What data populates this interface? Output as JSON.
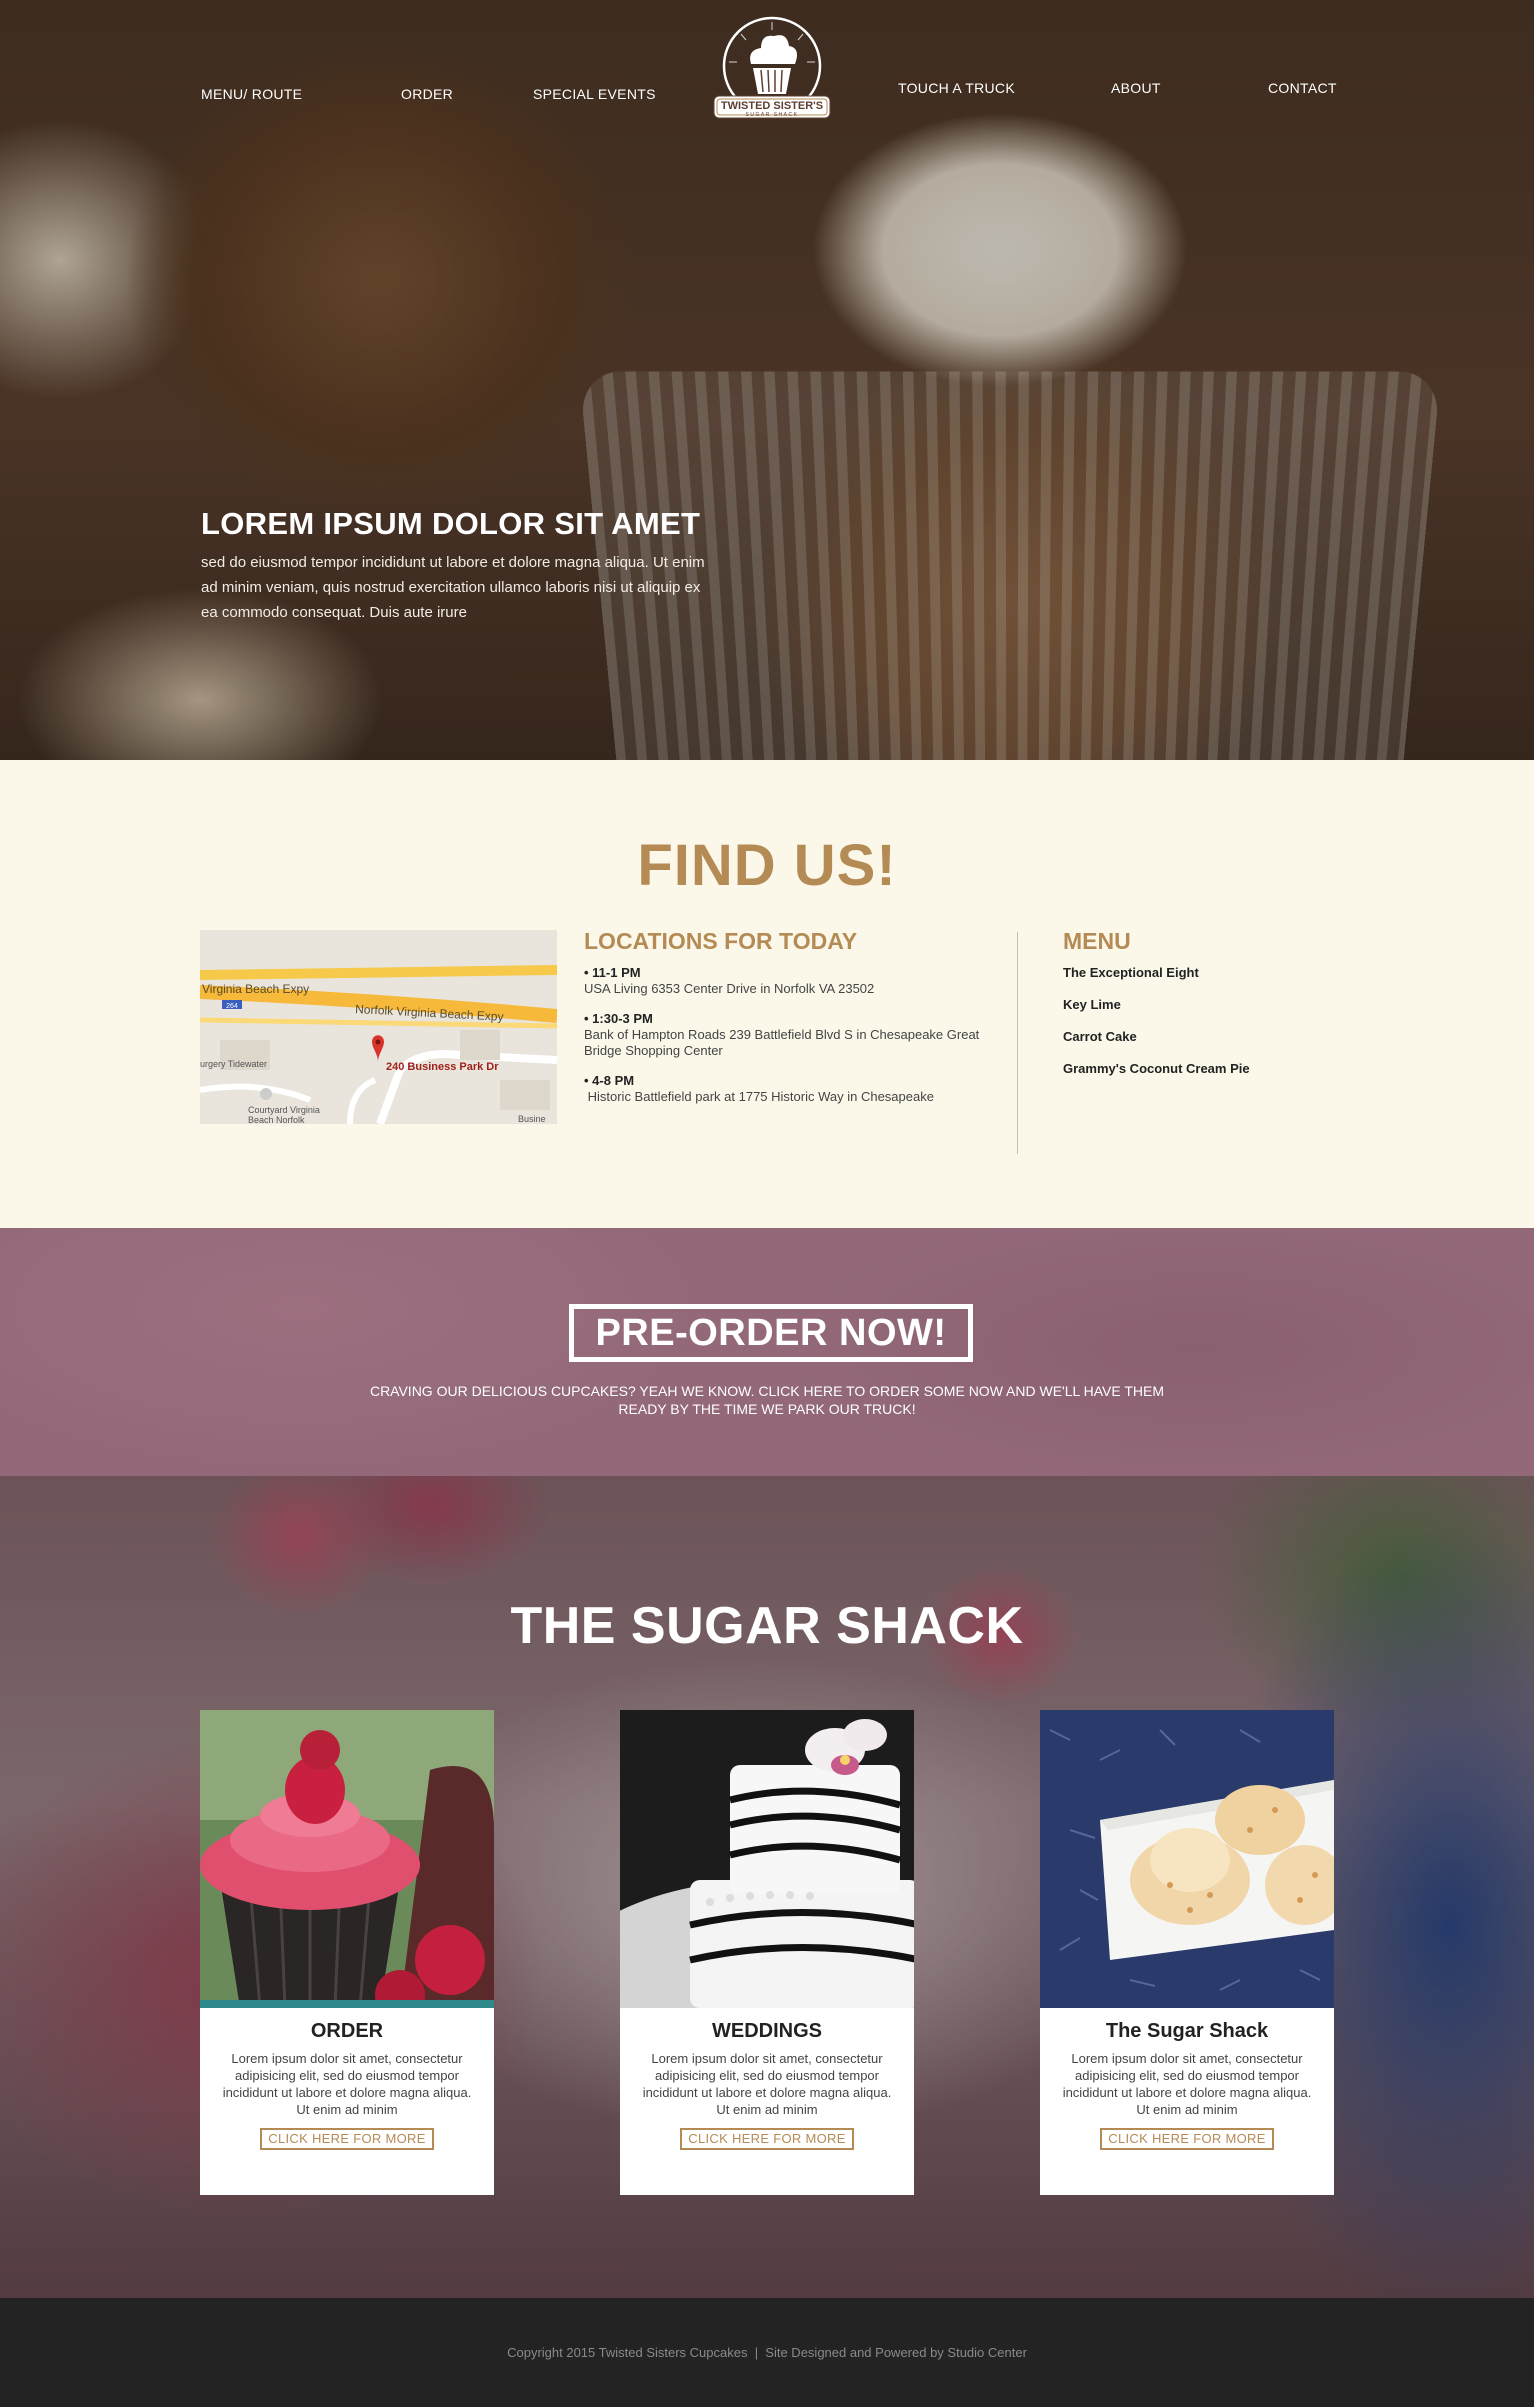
{
  "nav": {
    "left": [
      "MENU/ ROUTE",
      "ORDER",
      "SPECIAL EVENTS"
    ],
    "right": [
      "TOUCH A TRUCK",
      "ABOUT",
      "CONTACT"
    ],
    "logo_text": "TWISTED SISTER'S",
    "logo_sub": "SUGAR SHACK"
  },
  "hero": {
    "title": "LOREM IPSUM DOLOR SIT AMET",
    "body": "sed do eiusmod tempor incididunt ut labore et dolore magna aliqua. Ut enim ad minim veniam, quis nostrud exercitation ullamco laboris nisi ut aliquip ex ea commodo consequat. Duis aute irure"
  },
  "find": {
    "title": "FIND US!",
    "map": {
      "road1": "Virginia Beach Expy",
      "road2": "Norfolk Virginia Beach Expy",
      "shield": "264",
      "pin_label": "240 Business Park Dr",
      "poi1": "urgery Tidewater",
      "poi2": "Courtyard Virginia",
      "poi3": "Beach Norfolk",
      "poi4": "Busine"
    },
    "locations_title": "LOCATIONS FOR TODAY",
    "locations": [
      {
        "time": "11-1 PM",
        "addr": "USA Living 6353 Center Drive in Norfolk VA 23502"
      },
      {
        "time": "1:30-3 PM",
        "addr": "Bank of Hampton Roads 239 Battlefield Blvd S in Chesapeake Great Bridge Shopping Center"
      },
      {
        "time": "4-8 PM",
        "addr": " Historic Battlefield park at 1775 Historic Way in Chesapeake"
      }
    ],
    "menu_title": "MENU",
    "menu": [
      "The Exceptional Eight",
      "Key Lime",
      "Carrot Cake",
      "Grammy's Coconut Cream Pie"
    ]
  },
  "preorder": {
    "button": "PRE-ORDER NOW!",
    "text": "CRAVING OUR DELICIOUS CUPCAKES? YEAH WE KNOW. CLICK HERE TO ORDER SOME NOW AND WE'LL HAVE THEM READY BY THE TIME WE PARK OUR TRUCK!"
  },
  "shack": {
    "title": "THE SUGAR SHACK",
    "cards": [
      {
        "title": "ORDER",
        "text": "Lorem ipsum dolor sit amet, consectetur adipisicing elit, sed do eiusmod tempor incididunt ut labore et dolore magna aliqua. Ut enim ad minim",
        "link": "CLICK HERE FOR MORE"
      },
      {
        "title": "WEDDINGS",
        "text": "Lorem ipsum dolor sit amet, consectetur adipisicing elit, sed do eiusmod tempor incididunt ut labore et dolore magna aliqua. Ut enim ad minim",
        "link": "CLICK HERE FOR MORE"
      },
      {
        "title": "The Sugar Shack",
        "text": "Lorem ipsum dolor sit amet, consectetur adipisicing elit, sed do eiusmod tempor incididunt ut labore et dolore magna aliqua. Ut enim ad minim",
        "link": "CLICK HERE FOR MORE"
      }
    ]
  },
  "footer": {
    "text": "Copyright 2015 Twisted Sisters Cupcakes  |  Site Designed and Powered by Studio Center"
  },
  "colors": {
    "accent": "#b48a55",
    "preorder_bg": "#93697a",
    "cream_bg": "#fbf8ea",
    "footer_bg": "#232323"
  }
}
